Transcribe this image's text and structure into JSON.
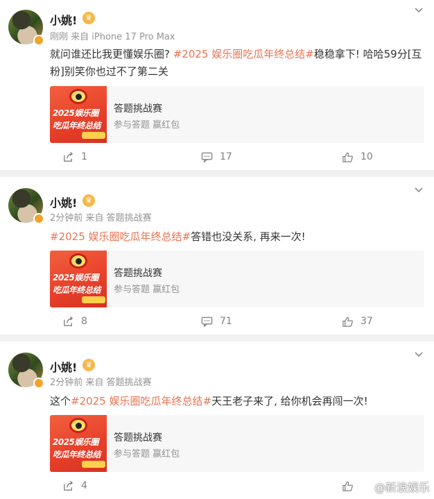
{
  "posts": [
    {
      "username": "小姚!",
      "meta": "刚刚  来自 iPhone 17 Pro Max",
      "text_before": "就问谁还比我更懂娱乐圈? ",
      "topic": "#2025 娱乐圈吃瓜年终总结#",
      "text_after": "稳稳拿下! 哈哈59分[互粉]别笑你也过不了第二关",
      "card": {
        "title": "答题挑战赛",
        "subtitle": "参与答题 赢红包",
        "thumb_line1": "2025娱乐圈",
        "thumb_line2": "吃瓜年终总结"
      },
      "share": "1",
      "comments": "17",
      "likes": "10"
    },
    {
      "username": "小姚!",
      "meta": "2分钟前  来自 答题挑战赛",
      "text_before": "",
      "topic": "#2025 娱乐圈吃瓜年终总结#",
      "text_after": "答错也没关系, 再来一次!",
      "card": {
        "title": "答题挑战赛",
        "subtitle": "参与答题 赢红包",
        "thumb_line1": "2025娱乐圈",
        "thumb_line2": "吃瓜年终总结"
      },
      "share": "8",
      "comments": "71",
      "likes": "37"
    },
    {
      "username": "小姚!",
      "meta": "2分钟前  来自 答题挑战赛",
      "text_before": "这个",
      "topic": "#2025 娱乐圈吃瓜年终总结#",
      "text_after": "天王老子来了, 给你机会再闯一次!",
      "card": {
        "title": "答题挑战赛",
        "subtitle": "参与答题 赢红包",
        "thumb_line1": "2025娱乐圈",
        "thumb_line2": "吃瓜年终总结"
      },
      "share": "4"
    }
  ],
  "watermark": "@新浪娱乐",
  "icons": {
    "vip": "crown-badge-icon",
    "chevron": "chevron-down-icon",
    "share": "share-icon",
    "comment": "comment-icon",
    "like": "thumbs-up-icon",
    "weibo": "weibo-logo-icon"
  },
  "colors": {
    "topic": "#eb7350",
    "meta": "#939393",
    "separator": "#f1f1f1",
    "card_bg": "#f7f7f7"
  }
}
